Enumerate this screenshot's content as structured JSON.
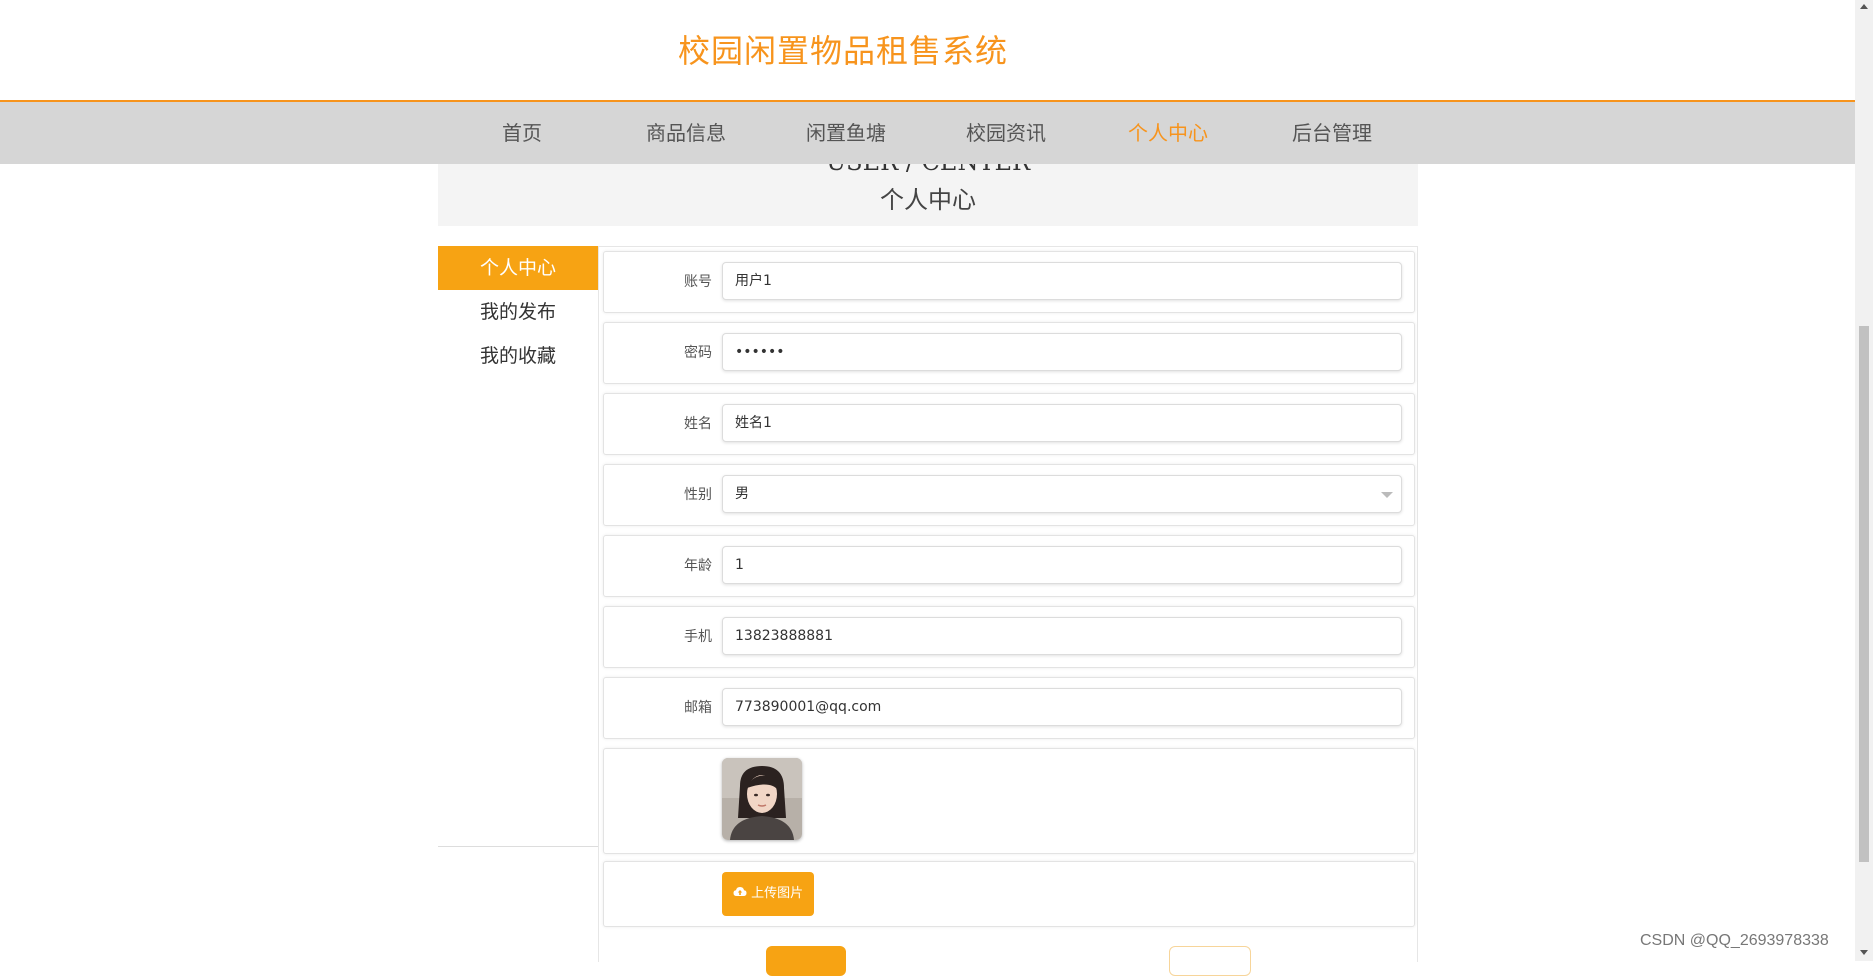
{
  "header": {
    "title": "校园闲置物品租售系统"
  },
  "nav": {
    "items": [
      {
        "label": "首页"
      },
      {
        "label": "商品信息"
      },
      {
        "label": "闲置鱼塘"
      },
      {
        "label": "校园资讯"
      },
      {
        "label": "个人中心",
        "active": true
      },
      {
        "label": "后台管理"
      }
    ]
  },
  "banner": {
    "title_en": "USER / CENTER",
    "title_cn": "个人中心"
  },
  "sidebar": {
    "items": [
      {
        "label": "个人中心",
        "active": true
      },
      {
        "label": "我的发布"
      },
      {
        "label": "我的收藏"
      }
    ]
  },
  "form": {
    "account": {
      "label": "账号",
      "value": "用户1"
    },
    "password": {
      "label": "密码",
      "value": "••••••"
    },
    "name": {
      "label": "姓名",
      "value": "姓名1"
    },
    "gender": {
      "label": "性别",
      "value": "男"
    },
    "age": {
      "label": "年龄",
      "value": "1"
    },
    "phone": {
      "label": "手机",
      "value": "13823888881"
    },
    "email": {
      "label": "邮箱",
      "value": "773890001@qq.com"
    },
    "upload_label": "上传图片"
  },
  "colors": {
    "accent": "#f7941d",
    "button": "#f7a313",
    "nav_bg": "#d6d6d6"
  },
  "icons": {
    "upload": "cloud-upload-icon"
  },
  "watermark": "CSDN @QQ_2693978338"
}
